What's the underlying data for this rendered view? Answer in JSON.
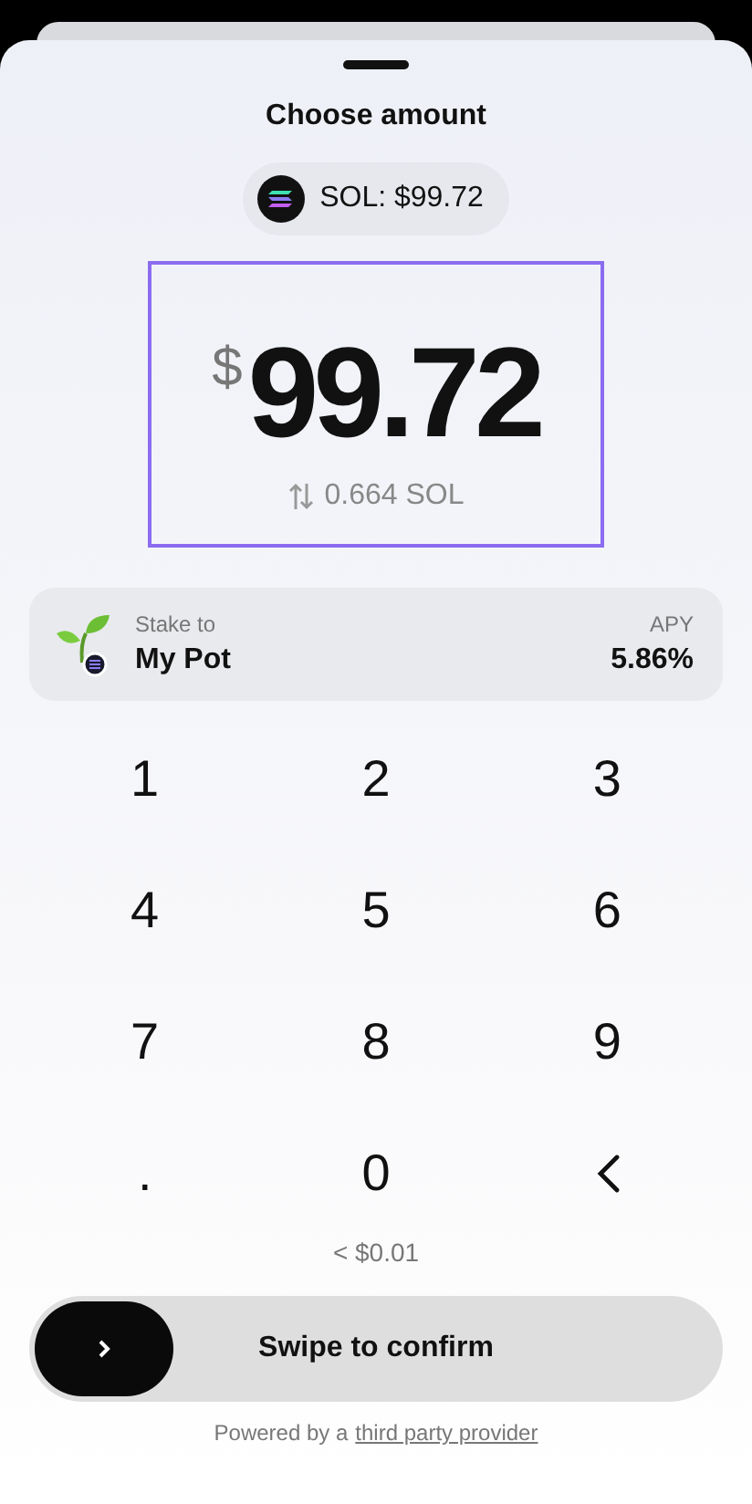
{
  "sheet": {
    "title": "Choose amount"
  },
  "token_pill": {
    "label": "SOL: $99.72"
  },
  "amount": {
    "currency": "$",
    "value": "99.72",
    "conversion": "0.664 SOL"
  },
  "stake": {
    "label": "Stake to",
    "pot": "My Pot",
    "apy_label": "APY",
    "apy": "5.86%"
  },
  "keypad": [
    {
      "kind": "digit",
      "label": "1"
    },
    {
      "kind": "digit",
      "label": "2"
    },
    {
      "kind": "digit",
      "label": "3"
    },
    {
      "kind": "digit",
      "label": "4"
    },
    {
      "kind": "digit",
      "label": "5"
    },
    {
      "kind": "digit",
      "label": "6"
    },
    {
      "kind": "digit",
      "label": "7"
    },
    {
      "kind": "digit",
      "label": "8"
    },
    {
      "kind": "digit",
      "label": "9"
    },
    {
      "kind": "digit",
      "label": "."
    },
    {
      "kind": "digit",
      "label": "0"
    },
    {
      "kind": "backspace"
    }
  ],
  "fee": "< $0.01",
  "swipe": {
    "label": "Swipe to confirm"
  },
  "footer": {
    "text": "Powered by a",
    "link": "third party provider"
  }
}
